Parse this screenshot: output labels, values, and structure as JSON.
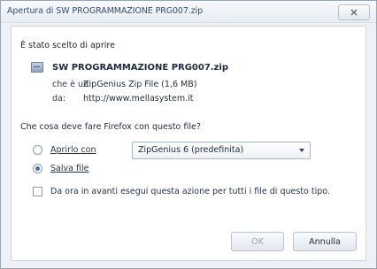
{
  "window": {
    "title": "Apertura di SW PROGRAMMAZIONE PRG007.zip",
    "close_glyph": "✕"
  },
  "dialog": {
    "hint": "È stato scelto di aprire",
    "file": {
      "icon": "zip-file-icon",
      "name": "SW PROGRAMMAZIONE PRG007.zip",
      "type_label": "che è un:",
      "type_value": "ZipGenius Zip File (1,6 MB)",
      "source_label": "da:",
      "source_value": "http://www.mellasystem.it"
    },
    "question": "Che cosa deve fare Firefox con questo file?",
    "options": {
      "open_with_label": "Aprirlo con",
      "open_with_app": "ZipGenius 6 (predefinita)",
      "save_label": "Salva file",
      "selected": "save"
    },
    "remember_label": "Da ora in avanti esegui questa azione per tutti i file di questo tipo.",
    "remember_checked": false,
    "buttons": {
      "ok": "OK",
      "cancel": "Annulla"
    }
  }
}
